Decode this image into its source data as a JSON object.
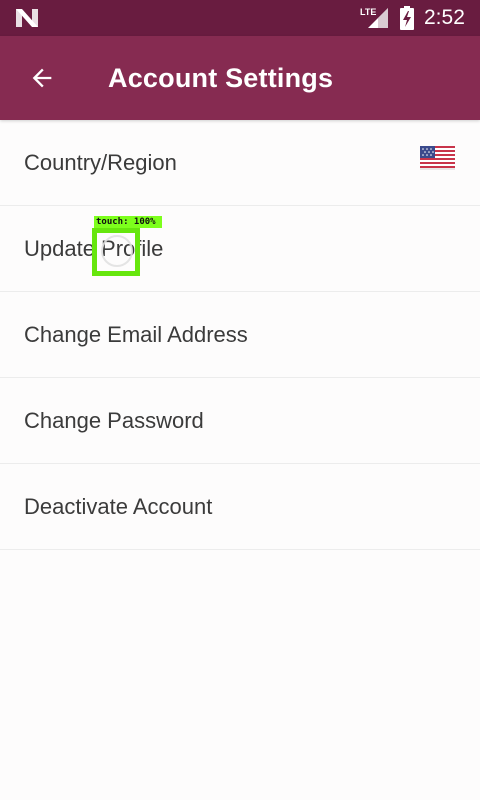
{
  "status_bar": {
    "time": "2:52",
    "network_label": "LTE",
    "icons": [
      "n-logo-icon",
      "lte-signal-icon",
      "battery-charging-icon"
    ]
  },
  "app_bar": {
    "title": "Account Settings",
    "back_icon": "arrow-left-icon",
    "background": "#862b51",
    "status_background": "#691c40"
  },
  "settings": {
    "items": [
      {
        "label": "Country/Region",
        "trailing_icon": "us-flag-icon"
      },
      {
        "label": "Update Profile"
      },
      {
        "label": "Change Email Address"
      },
      {
        "label": "Change Password"
      },
      {
        "label": "Deactivate Account"
      }
    ]
  },
  "touch_indicator": {
    "label": "touch: 100%",
    "color": "#66e60d"
  }
}
